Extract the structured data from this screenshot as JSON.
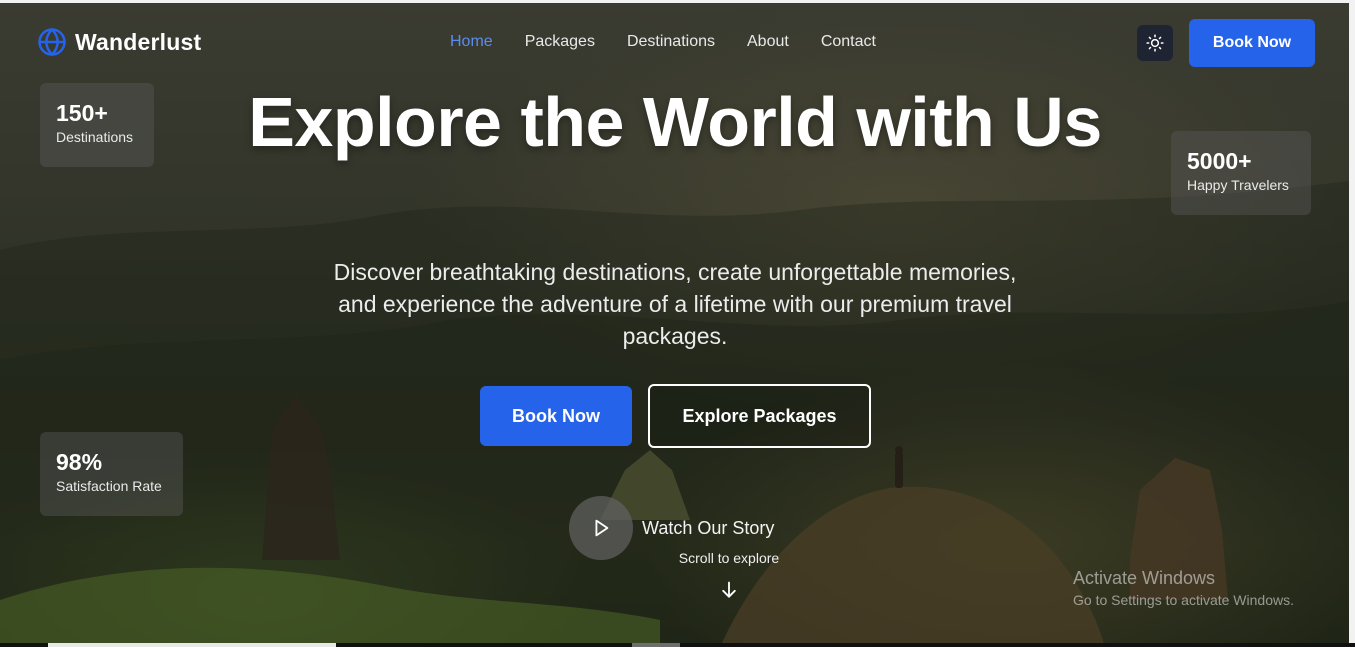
{
  "nav": {
    "brand": "Wanderlust",
    "links": [
      "Home",
      "Packages",
      "Destinations",
      "About",
      "Contact"
    ],
    "active_link": "Home",
    "theme_icon": "sun-icon",
    "book_label": "Book Now"
  },
  "stats": [
    {
      "value": "150+",
      "label": "Destinations"
    },
    {
      "value": "5000+",
      "label": "Happy Travelers"
    },
    {
      "value": "98%",
      "label": "Satisfaction Rate"
    }
  ],
  "hero": {
    "headline": "Explore the World with Us",
    "subtitle": "Discover breathtaking destinations, create unforgettable memories, and experience the adventure of a lifetime with our premium travel packages.",
    "primary_cta": "Book Now",
    "secondary_cta": "Explore Packages",
    "watch_label": "Watch Our Story",
    "scroll_label": "Scroll to explore"
  },
  "watermark": {
    "title": "Activate Windows",
    "subtitle": "Go to Settings to activate Windows."
  },
  "colors": {
    "accent": "#2563eb",
    "active_link": "#5b8dee",
    "theme_button_bg": "#1e2431"
  }
}
